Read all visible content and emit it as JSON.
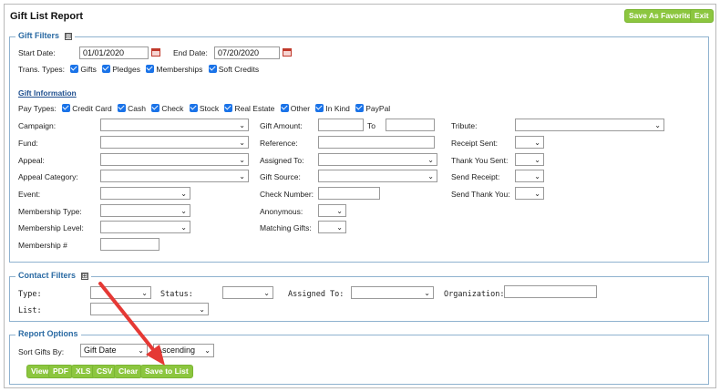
{
  "header": {
    "title": "Gift List Report",
    "save_favorite": "Save As Favorite",
    "exit": "Exit"
  },
  "gift_filters": {
    "legend": "Gift Filters",
    "toggle": "⊟",
    "start_date_label": "Start Date:",
    "start_date": "01/01/2020",
    "end_date_label": "End Date:",
    "end_date": "07/20/2020",
    "trans_types_label": "Trans. Types:",
    "trans_types": [
      "Gifts",
      "Pledges",
      "Memberships",
      "Soft Credits"
    ],
    "gift_information": "Gift Information",
    "pay_types_label": "Pay Types:",
    "pay_types": [
      "Credit Card",
      "Cash",
      "Check",
      "Stock",
      "Real Estate",
      "Other",
      "In Kind",
      "PayPal"
    ],
    "campaign": "Campaign:",
    "fund": "Fund:",
    "appeal": "Appeal:",
    "appeal_category": "Appeal Category:",
    "event": "Event:",
    "membership_type": "Membership Type:",
    "membership_level": "Membership Level:",
    "membership_no": "Membership #",
    "gift_amount": "Gift Amount:",
    "to": "To",
    "reference": "Reference:",
    "assigned_to": "Assigned To:",
    "gift_source": "Gift Source:",
    "check_number": "Check Number:",
    "anonymous": "Anonymous:",
    "matching_gifts": "Matching Gifts:",
    "tribute": "Tribute:",
    "receipt_sent": "Receipt Sent:",
    "thank_you_sent": "Thank You Sent:",
    "send_receipt": "Send Receipt:",
    "send_thank_you": "Send Thank You:"
  },
  "contact_filters": {
    "legend": "Contact Filters",
    "toggle": "⊞",
    "type": "Type:",
    "status": "Status:",
    "assigned_to": "Assigned To:",
    "organization": "Organization:",
    "list": "List:"
  },
  "report_options": {
    "legend": "Report Options",
    "sort_label": "Sort Gifts By:",
    "sort_value": "Gift Date",
    "order_value": "Ascending",
    "buttons": [
      "View",
      "PDF",
      "XLS",
      "CSV",
      "Clear",
      "Save to List"
    ]
  },
  "colors": {
    "button_green": "#8cc63f",
    "legend_blue": "#2a6aa3",
    "checkbox_blue": "#1a73e8",
    "arrow_red": "#e53935"
  }
}
